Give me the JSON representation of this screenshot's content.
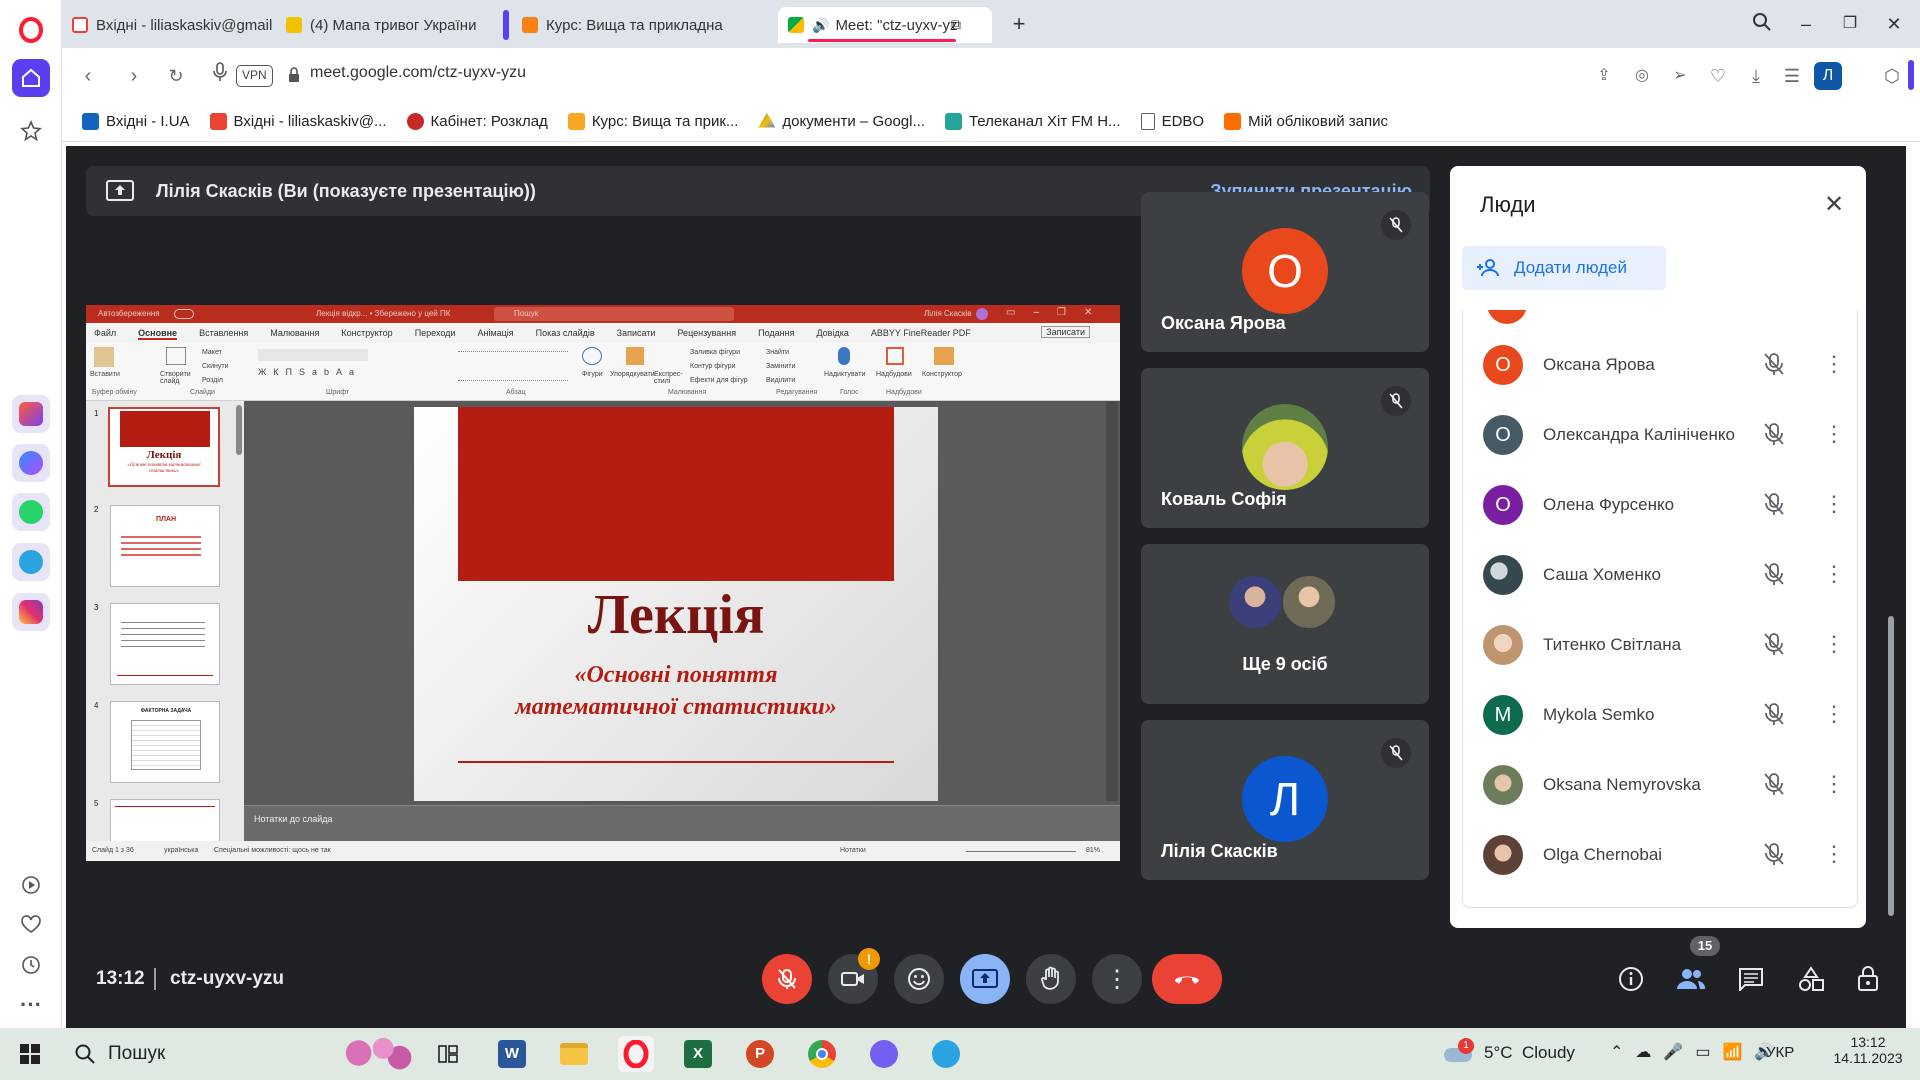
{
  "tabs": [
    {
      "label": "Вхідні - liliaskaskiv@gmail",
      "icon": "gmail-icon"
    },
    {
      "label": "(4) Мапа тривог України",
      "icon": "alert-map-icon"
    },
    {
      "label": "Курс: Вища та прикладна",
      "icon": "moodle-icon"
    },
    {
      "label": "Meet: \"ctz-uyxv-yz",
      "icon": "meet-icon"
    }
  ],
  "address": {
    "vpn": "VPN",
    "url": "meet.google.com/ctz-uyxv-yzu",
    "profile": "Л"
  },
  "bookmarks": [
    {
      "label": "Вхідні - I.UA",
      "color": "#1565c0"
    },
    {
      "label": "Вхідні - liliaskaskiv@...",
      "color": "#ea4335"
    },
    {
      "label": "Кабінет: Розклад",
      "color": "#c62828"
    },
    {
      "label": "Курс: Вища та прик...",
      "color": "#f9a825"
    },
    {
      "label": "документи – Googl...",
      "color": "#34a853"
    },
    {
      "label": "Телеканал Хіт FM Н...",
      "color": "#26a69a"
    },
    {
      "label": "EDBO",
      "color": "#616161"
    },
    {
      "label": "Мій обліковий запис",
      "color": "#ff6d00"
    }
  ],
  "presentation": {
    "presenter": "Лілія Скасків (Ви (показуєте презентацію))",
    "stop": "Зупинити презентацію"
  },
  "ppt": {
    "autosave": "Автозбереження",
    "doc_title": "Лекція відкр... • Збережено у цей ПК",
    "search": "Пошук",
    "user": "Лілія Скасків",
    "record": "Записати",
    "ribbon_tabs": [
      "Файл",
      "Основне",
      "Вставлення",
      "Малювання",
      "Конструктор",
      "Переходи",
      "Анімація",
      "Показ слайдів",
      "Записати",
      "Рецензування",
      "Подання",
      "Довідка",
      "ABBYY FineReader PDF"
    ],
    "groups": [
      "Буфер обміну",
      "Слайди",
      "Шрифт",
      "Абзац",
      "Малювання",
      "Редагування",
      "Голос",
      "Надбудови"
    ],
    "ribbon_buttons": [
      "Вставити",
      "Створити слайд",
      "Макет",
      "Скинути",
      "Розділ",
      "Фігури",
      "Упорядкувати",
      "Експрес-стилі",
      "Заливка фігури",
      "Контур фігури",
      "Ефекти для фігур",
      "Знайти",
      "Замінити",
      "Виділити",
      "Надиктувати",
      "Надбудови",
      "Конструктор"
    ],
    "thumb_numbers": [
      "1",
      "2",
      "3",
      "4",
      "5"
    ],
    "thumb1_title": "Лекція",
    "thumb1_sub": "«Основні поняття математичної статистики»",
    "thumb2_title": "ПЛАН",
    "thumb4_title": "ФАКТОРНА ЗАДАЧА",
    "slide_title": "Лекція",
    "slide_sub_1": "«Основні поняття",
    "slide_sub_2": "математичної статистики»",
    "notes": "Нотатки до слайда",
    "status_slide": "Слайд 1 з 36",
    "status_lang": "українська",
    "status_access": "Спеціальні можливості: щось не так",
    "status_notes": "Нотатки",
    "zoom": "81%"
  },
  "tiles": [
    {
      "name": "Оксана Ярова",
      "initial": "О",
      "color": "#e8481b"
    },
    {
      "name": "Коваль Софія"
    },
    {
      "name": "Ще 9 осіб"
    },
    {
      "name": "Лілія Скасків",
      "initial": "Л",
      "color": "#0b57d0"
    }
  ],
  "people": {
    "title": "Люди",
    "add": "Додати людей",
    "list": [
      {
        "name": "Оксана Ярова",
        "initial": "О",
        "color": "#e8481b"
      },
      {
        "name": "Олександра Калініченко",
        "initial": "О",
        "color": "#455a64"
      },
      {
        "name": "Олена Фурсенко",
        "initial": "О",
        "color": "#7b1fa2"
      },
      {
        "name": "Саша Хоменко",
        "initial": "",
        "color": "#37474f"
      },
      {
        "name": "Титенко Світлана",
        "initial": "",
        "color": "#bf9570"
      },
      {
        "name": "Mykola Semko",
        "initial": "M",
        "color": "#0e6b4f"
      },
      {
        "name": "Oksana Nemyrovska",
        "initial": "",
        "color": "#6d7c5a"
      },
      {
        "name": "Olga Chernobai",
        "initial": "",
        "color": "#5d4037"
      }
    ]
  },
  "footer": {
    "time": "13:12",
    "code": "ctz-uyxv-yzu",
    "people_count": "15",
    "cam_alert": "!"
  },
  "taskbar": {
    "search": "Пошук",
    "weather": "5°C  Cloudy",
    "weather_badge": "1",
    "lang": "УКР",
    "time": "13:12",
    "date": "14.11.2023"
  }
}
